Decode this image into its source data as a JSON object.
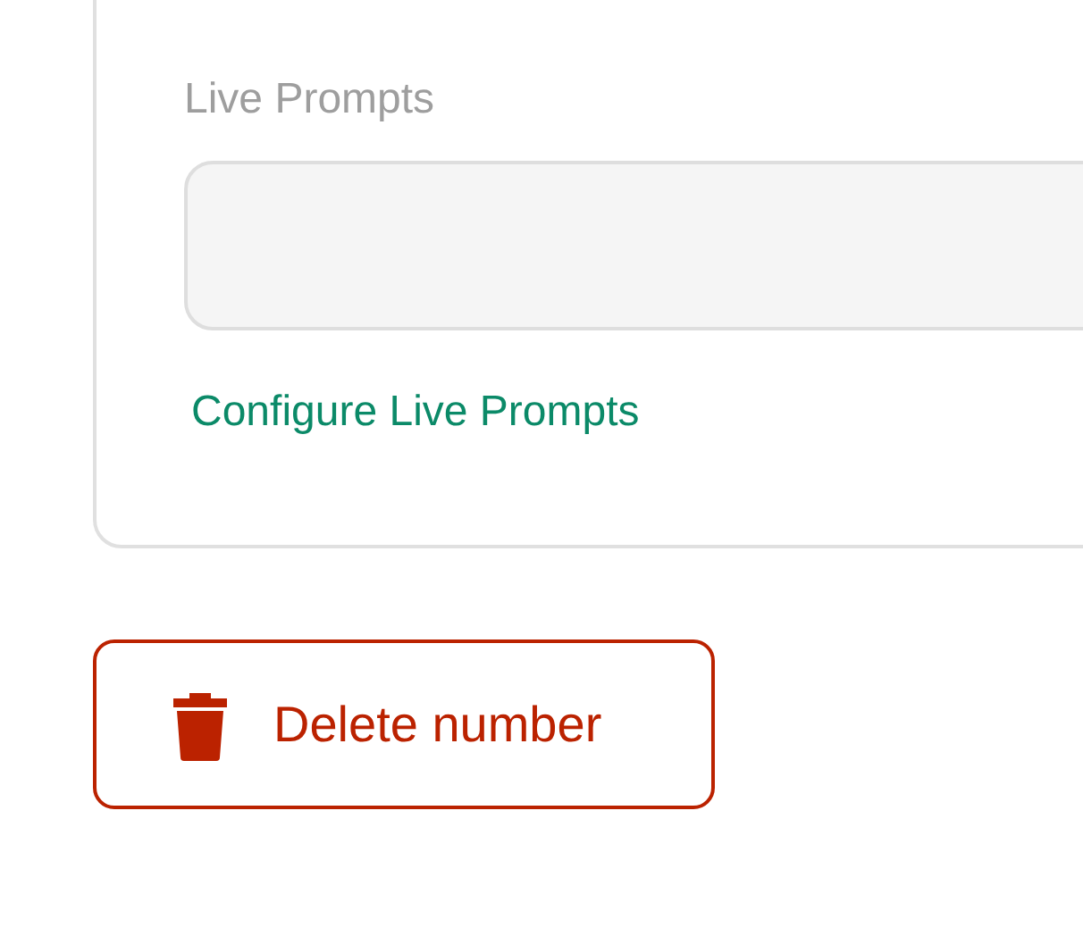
{
  "live_prompts": {
    "label": "Live Prompts",
    "link": "Configure Live Prompts"
  },
  "delete_button": {
    "label": "Delete number"
  }
}
